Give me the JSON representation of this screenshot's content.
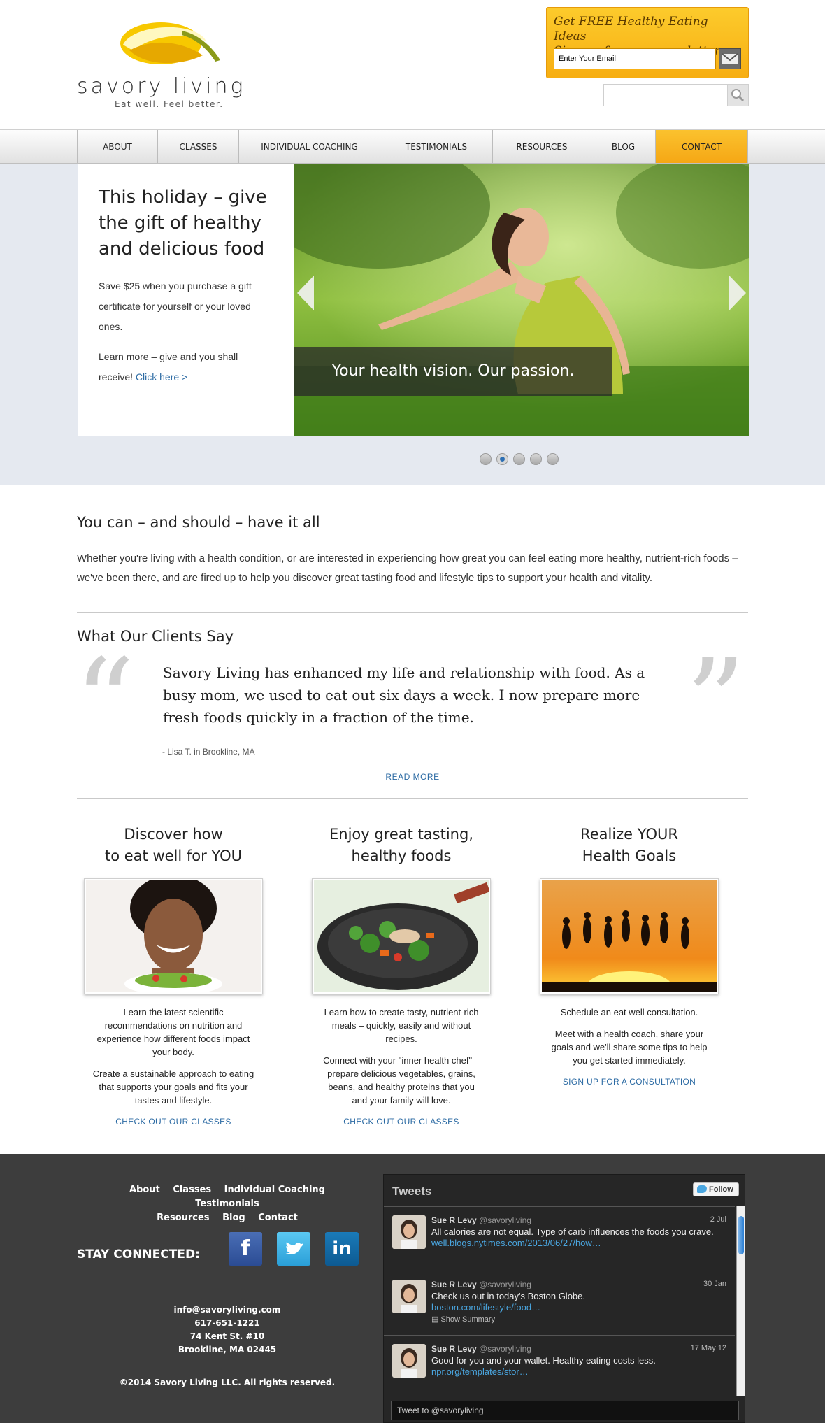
{
  "brand": {
    "name": "savory living",
    "tagline": "Eat well. Feel better."
  },
  "newsletter": {
    "title_line1": "Get FREE Healthy Eating Ideas",
    "title_line2": "Sign up for our enewsletter",
    "placeholder": "Enter Your Email",
    "submit_icon": "envelope-icon"
  },
  "search": {
    "icon": "magnifier-icon"
  },
  "nav": {
    "items": [
      {
        "label": "ABOUT"
      },
      {
        "label": "CLASSES"
      },
      {
        "label": "INDIVIDUAL COACHING"
      },
      {
        "label": "TESTIMONIALS"
      },
      {
        "label": "RESOURCES"
      },
      {
        "label": "BLOG"
      },
      {
        "label": "CONTACT"
      }
    ],
    "active": "CONTACT"
  },
  "hero": {
    "title": "This holiday – give the gift of healthy and delicious food",
    "body1": "Save $25 when you purchase a gift certificate for yourself or your loved ones.",
    "body2": "Learn more – give and you shall receive!",
    "link": "Click here >",
    "caption": "Your health vision. Our passion.",
    "slide_index": 2,
    "slide_count": 5
  },
  "intro": {
    "heading": "You can – and should – have it all",
    "text": "Whether you're living with a health condition, or are interested in experiencing how great you can feel eating more healthy, nutrient-rich foods – we've been there, and are fired up to help you discover great tasting food and lifestyle tips to support your health and vitality."
  },
  "testimonials": {
    "heading": "What Our Clients Say",
    "quote": "Savory Living has enhanced my life and relationship with food. As a busy mom, we used to eat out six days a week. I now prepare more fresh foods quickly in a fraction of the time.",
    "author": "- Lisa T. in Brookline, MA",
    "read_more": "READ MORE"
  },
  "columns": [
    {
      "title1": "Discover how",
      "title2": "to eat well for YOU",
      "p1": "Learn the latest scientific recommendations on nutrition and experience how different foods impact your body.",
      "p2": "Create a sustainable approach to eating that supports your goals and fits your tastes and lifestyle.",
      "link": "CHECK OUT OUR CLASSES"
    },
    {
      "title1": "Enjoy great tasting,",
      "title2": "healthy foods",
      "p1": "Learn how to create tasty, nutrient-rich meals – quickly, easily and without recipes.",
      "p2": "Connect with your \"inner health chef\" – prepare delicious vegetables, grains, beans, and healthy proteins that you and your family will love.",
      "link": "CHECK OUT OUR CLASSES"
    },
    {
      "title1": "Realize YOUR",
      "title2": "Health Goals",
      "p1": "Schedule an eat well consultation.",
      "p2": "Meet with a health coach, share your goals and we'll share some tips to help you get started immediately.",
      "link": "SIGN UP FOR A CONSULTATION"
    }
  ],
  "footer": {
    "links_row1": [
      "About",
      "Classes",
      "Individual Coaching",
      "Testimonials"
    ],
    "links_row2": [
      "Resources",
      "Blog",
      "Contact"
    ],
    "stay_connected": "STAY CONNECTED:",
    "social": [
      "facebook-icon",
      "twitter-icon",
      "linkedin-icon"
    ],
    "email": "info@savoryliving.com",
    "phone": "617-651-1221",
    "address1": "74 Kent St. #10",
    "address2": "Brookline, MA 02445",
    "copyright": "©2014 Savory Living LLC. All rights reserved."
  },
  "twitter": {
    "heading": "Tweets",
    "follow": "Follow",
    "tweet_box": "Tweet to @savoryliving",
    "tweets": [
      {
        "name": "Sue R Levy",
        "handle": "@savoryliving",
        "date": "2 Jul",
        "text": "All calories are not equal. Type of carb influences the foods you crave.",
        "url": "well.blogs.nytimes.com/2013/06/27/how…",
        "summary": ""
      },
      {
        "name": "Sue R Levy",
        "handle": "@savoryliving",
        "date": "30 Jan",
        "text": "Check us out in today's Boston Globe.",
        "url": "boston.com/lifestyle/food…",
        "summary": "Show Summary"
      },
      {
        "name": "Sue R Levy",
        "handle": "@savoryliving",
        "date": "17 May 12",
        "text": "Good for you and your wallet. Healthy eating costs less.",
        "url": "npr.org/templates/stor…",
        "summary": ""
      }
    ]
  },
  "colors": {
    "accent_orange": "#f7ae12",
    "link_blue": "#2b6aa3",
    "footer_bg": "#3d3d3d",
    "hero_band": "#e5e9f0"
  }
}
